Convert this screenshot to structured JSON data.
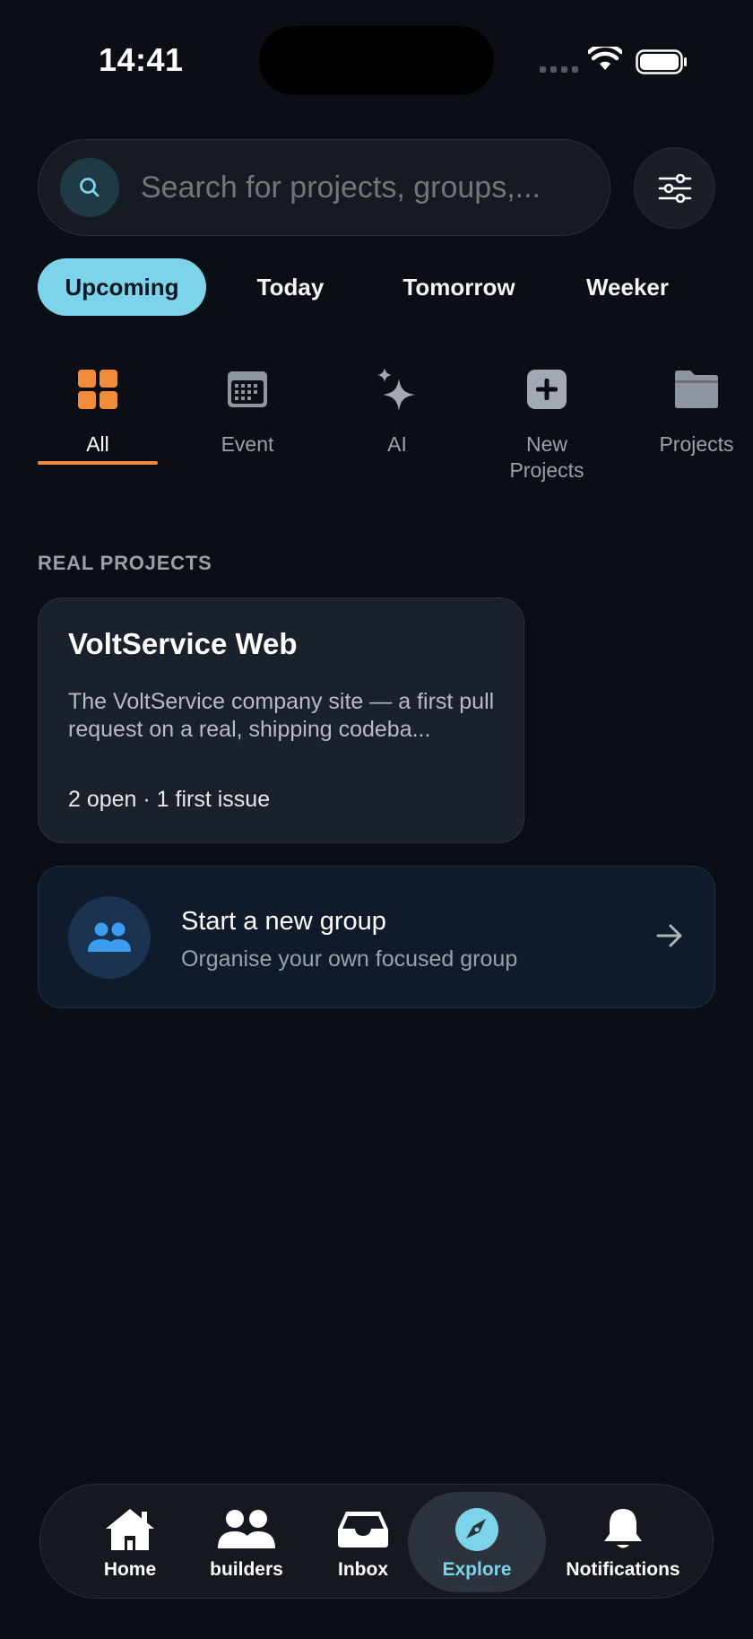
{
  "status_bar": {
    "time": "14:41"
  },
  "search": {
    "placeholder": "Search for projects, groups,..."
  },
  "time_tabs": [
    {
      "label": "Upcoming",
      "active": true
    },
    {
      "label": "Today"
    },
    {
      "label": "Tomorrow"
    },
    {
      "label": "Weeker"
    }
  ],
  "categories": [
    {
      "label": "All",
      "icon": "grid-icon",
      "active": true
    },
    {
      "label": "Event",
      "icon": "calendar-icon"
    },
    {
      "label": "AI",
      "icon": "sparkles-icon"
    },
    {
      "label": "New Projects",
      "icon": "plus-square-icon"
    },
    {
      "label": "Projects",
      "icon": "folder-icon"
    }
  ],
  "section": {
    "title": "REAL PROJECTS"
  },
  "project": {
    "title": "VoltService Web",
    "description": "The VoltService company site — a first pull request on a real, shipping codeba...",
    "meta": "2 open · 1 first issue"
  },
  "group_cta": {
    "title": "Start a new group",
    "subtitle": "Organise your own focused group"
  },
  "bottom_nav": [
    {
      "label": "Home",
      "icon": "home-icon"
    },
    {
      "label": "builders",
      "icon": "users-icon"
    },
    {
      "label": "Inbox",
      "icon": "inbox-icon"
    },
    {
      "label": "Explore",
      "icon": "compass-icon",
      "active": true
    },
    {
      "label": "Notifications",
      "icon": "bell-icon"
    }
  ],
  "colors": {
    "background": "#0b0e14",
    "accent": "#7dd3ea",
    "category_active": "#f08c3a",
    "group_icon": "#3b9cf0"
  }
}
